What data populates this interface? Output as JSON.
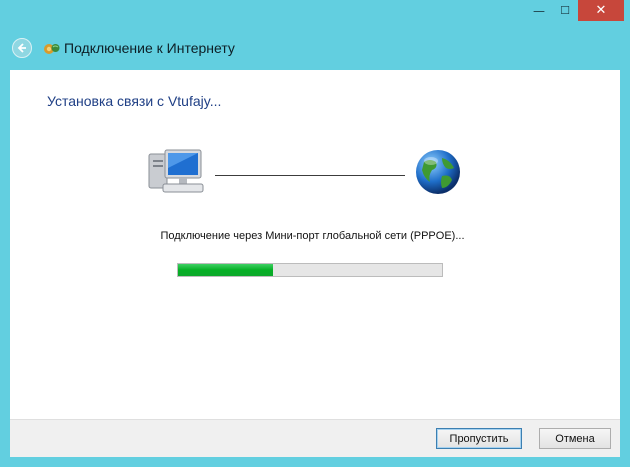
{
  "window": {
    "title": "Подключение к Интернету",
    "caption_buttons": {
      "minimize": "—",
      "maximize": "☐",
      "close": "✕"
    }
  },
  "main": {
    "heading": "Установка связи с Vtufajy...",
    "status_text": "Подключение через Мини-порт глобальной сети (PPPOE)...",
    "progress_fraction": 0.36,
    "icons": {
      "left": "computer-icon",
      "right": "globe-icon"
    }
  },
  "footer": {
    "skip_label": "Пропустить",
    "cancel_label": "Отмена"
  },
  "colors": {
    "frame": "#62cfe0",
    "close": "#c7473b",
    "heading": "#1f3f85",
    "progress": "#06b025"
  }
}
